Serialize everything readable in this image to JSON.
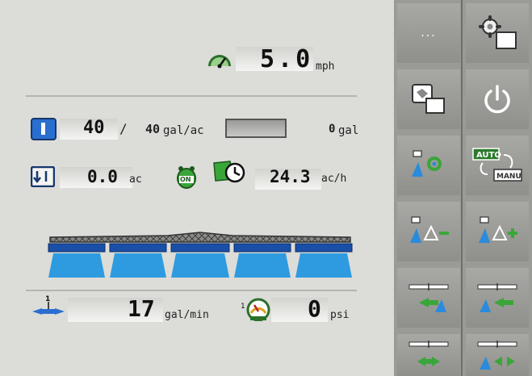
{
  "speed": {
    "value": "5.0",
    "unit": "mph",
    "icon": "speedometer-icon"
  },
  "rate": {
    "target": "40",
    "separator": "/",
    "actual": "40",
    "unit": "gal/ac",
    "tank_value": "0",
    "tank_unit": "gal"
  },
  "area": {
    "value": "0.0",
    "unit": "ac",
    "rate_value": "24.3",
    "rate_unit": "ac/h",
    "onoff_badge": "ON"
  },
  "flow": {
    "value": "17",
    "unit": "gal/min",
    "pressure_value": "0",
    "pressure_unit": "psi",
    "section_marker": "1"
  },
  "boom": {
    "sections": 5,
    "active_color": "#1a6fd6"
  },
  "sidebar": {
    "more_label": "...",
    "auto_label": "AUTO",
    "manu_label": "MANU",
    "buttons": [
      "more-button",
      "settings-button",
      "display-switch-button",
      "power-button",
      "section-target-button",
      "auto-manual-toggle-button",
      "rate-decrease-button",
      "rate-increase-button",
      "boom-shift-left-button",
      "boom-shift-right-button",
      "boom-fold-left-button",
      "boom-fold-right-button"
    ]
  },
  "colors": {
    "accent_blue": "#2a8bdc",
    "accent_green": "#3aa63a",
    "panel_bg": "#dcdcd8",
    "sidebar_bg": "#9a9a96"
  }
}
